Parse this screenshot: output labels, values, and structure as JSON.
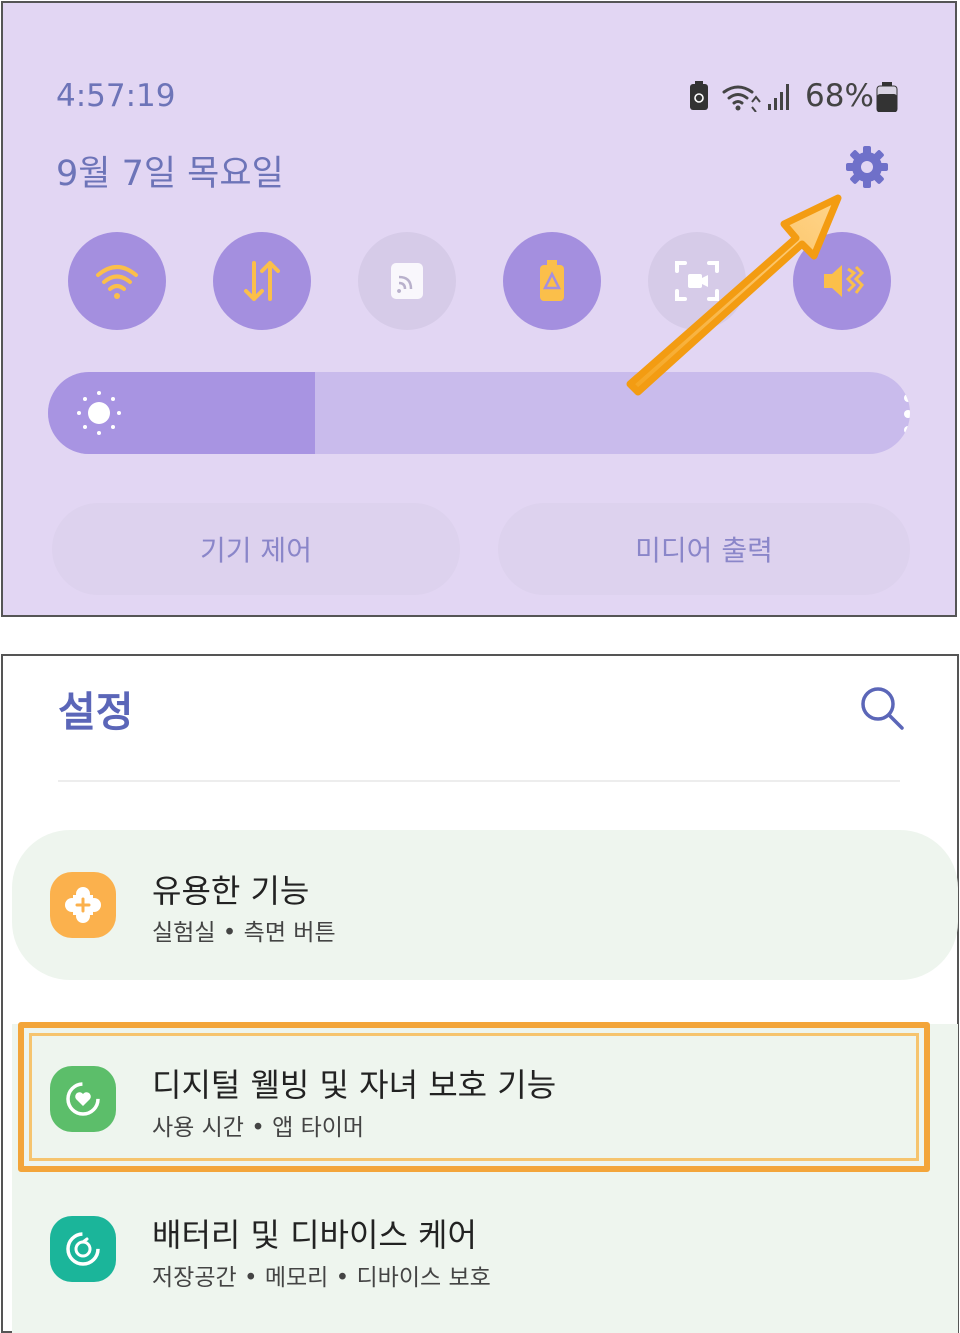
{
  "status_bar": {
    "time": "4:57:19",
    "date": "9월 7일 목요일",
    "battery_percent": "68%"
  },
  "quick_settings": {
    "tiles": [
      {
        "name": "wifi",
        "state": "on"
      },
      {
        "name": "mobile-data",
        "state": "on"
      },
      {
        "name": "cast",
        "state": "off"
      },
      {
        "name": "power-saving",
        "state": "on"
      },
      {
        "name": "screen-recorder",
        "state": "off"
      },
      {
        "name": "sound-mute",
        "state": "on"
      }
    ],
    "brightness_level": 0.31,
    "device_control_label": "기기 제어",
    "media_output_label": "미디어 출력"
  },
  "settings": {
    "title": "설정",
    "items": [
      {
        "title": "유용한 기능",
        "subtitle": "실험실  •  측면 버튼",
        "icon": "puzzle-icon",
        "color": "#fbb14d"
      },
      {
        "title": "디지털 웰빙 및 자녀 보호 기능",
        "subtitle": "사용 시간  •  앱 타이머",
        "icon": "wellbeing-icon",
        "color": "#5cbe6a"
      },
      {
        "title": "배터리 및 디바이스 케어",
        "subtitle": "저장공간  •  메모리  •  디바이스 보호",
        "icon": "device-care-icon",
        "color": "#1bb59a"
      }
    ]
  },
  "colors": {
    "panel_bg": "#e2d6f3",
    "tile_on": "#a48fdf",
    "tile_off": "#d6cbe8",
    "accent_text": "#6d74b8",
    "highlight": "#f3a53a"
  }
}
